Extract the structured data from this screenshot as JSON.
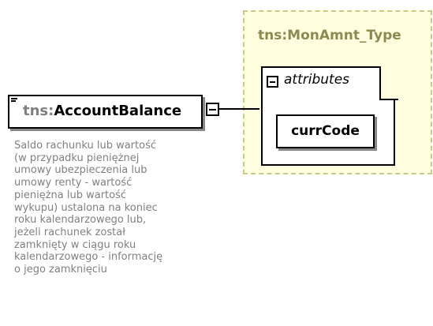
{
  "diagram": {
    "complex_type": {
      "name": "tns:MonAmnt_Type",
      "group_label": "attributes",
      "attributes": [
        "currCode"
      ]
    },
    "element": {
      "prefix": "tns:",
      "local_name": "AccountBalance",
      "documentation": "Saldo rachunku lub wartość\n(w przypadku pieniężnej\numowy ubezpieczenia lub\numowy renty - wartość\npieniężna lub wartość\nwykupu) ustalona na koniec\nroku kalendarzowego lub,\njeżeli rachunek został\nzamknięty w ciągu roku\nkalendarzowego - informację\no jego zamknięciu"
    }
  }
}
